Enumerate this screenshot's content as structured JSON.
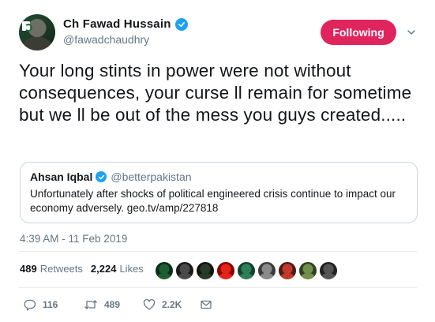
{
  "author": {
    "display_name": "Ch Fawad Hussain",
    "handle": "@fawadchaudhry",
    "verified": true
  },
  "follow_button": {
    "label": "Following",
    "color": "#e0245e"
  },
  "tweet": {
    "text": "Your long stints in power were not without consequences, your curse ll remain for sometime but we ll be out of the mess you guys created.....",
    "timestamp": "4:39 AM - 11 Feb 2019"
  },
  "quoted_tweet": {
    "display_name": "Ahsan Iqbal",
    "handle": "@betterpakistan",
    "verified": true,
    "text": "Unfortunately after shocks of political engineered crisis continue to impact our economy adversely. geo.tv/amp/227818"
  },
  "stats": {
    "retweets_count": "489",
    "retweets_label": "Retweets",
    "likes_count": "2,224",
    "likes_label": "Likes"
  },
  "liker_avatars": [
    {
      "color_a": "#1f5d32",
      "color_b": "#0e2d18"
    },
    {
      "color_a": "#4a4a4a",
      "color_b": "#1a1a1a"
    },
    {
      "color_a": "#2a3a2a",
      "color_b": "#0d160d"
    },
    {
      "color_a": "#e3241b",
      "color_b": "#8b0000"
    },
    {
      "color_a": "#2f7d5a",
      "color_b": "#134030"
    },
    {
      "color_a": "#8a8a8a",
      "color_b": "#3a3a3a"
    },
    {
      "color_a": "#c0392b",
      "color_b": "#4a1a14"
    },
    {
      "color_a": "#6f8f4a",
      "color_b": "#2f4020"
    },
    {
      "color_a": "#555555",
      "color_b": "#222222"
    }
  ],
  "actions": {
    "reply_count": "116",
    "retweet_count": "489",
    "like_count": "2.2K"
  },
  "colors": {
    "accent": "#1da1f2",
    "muted": "#657786",
    "border": "#ccd6dd"
  }
}
